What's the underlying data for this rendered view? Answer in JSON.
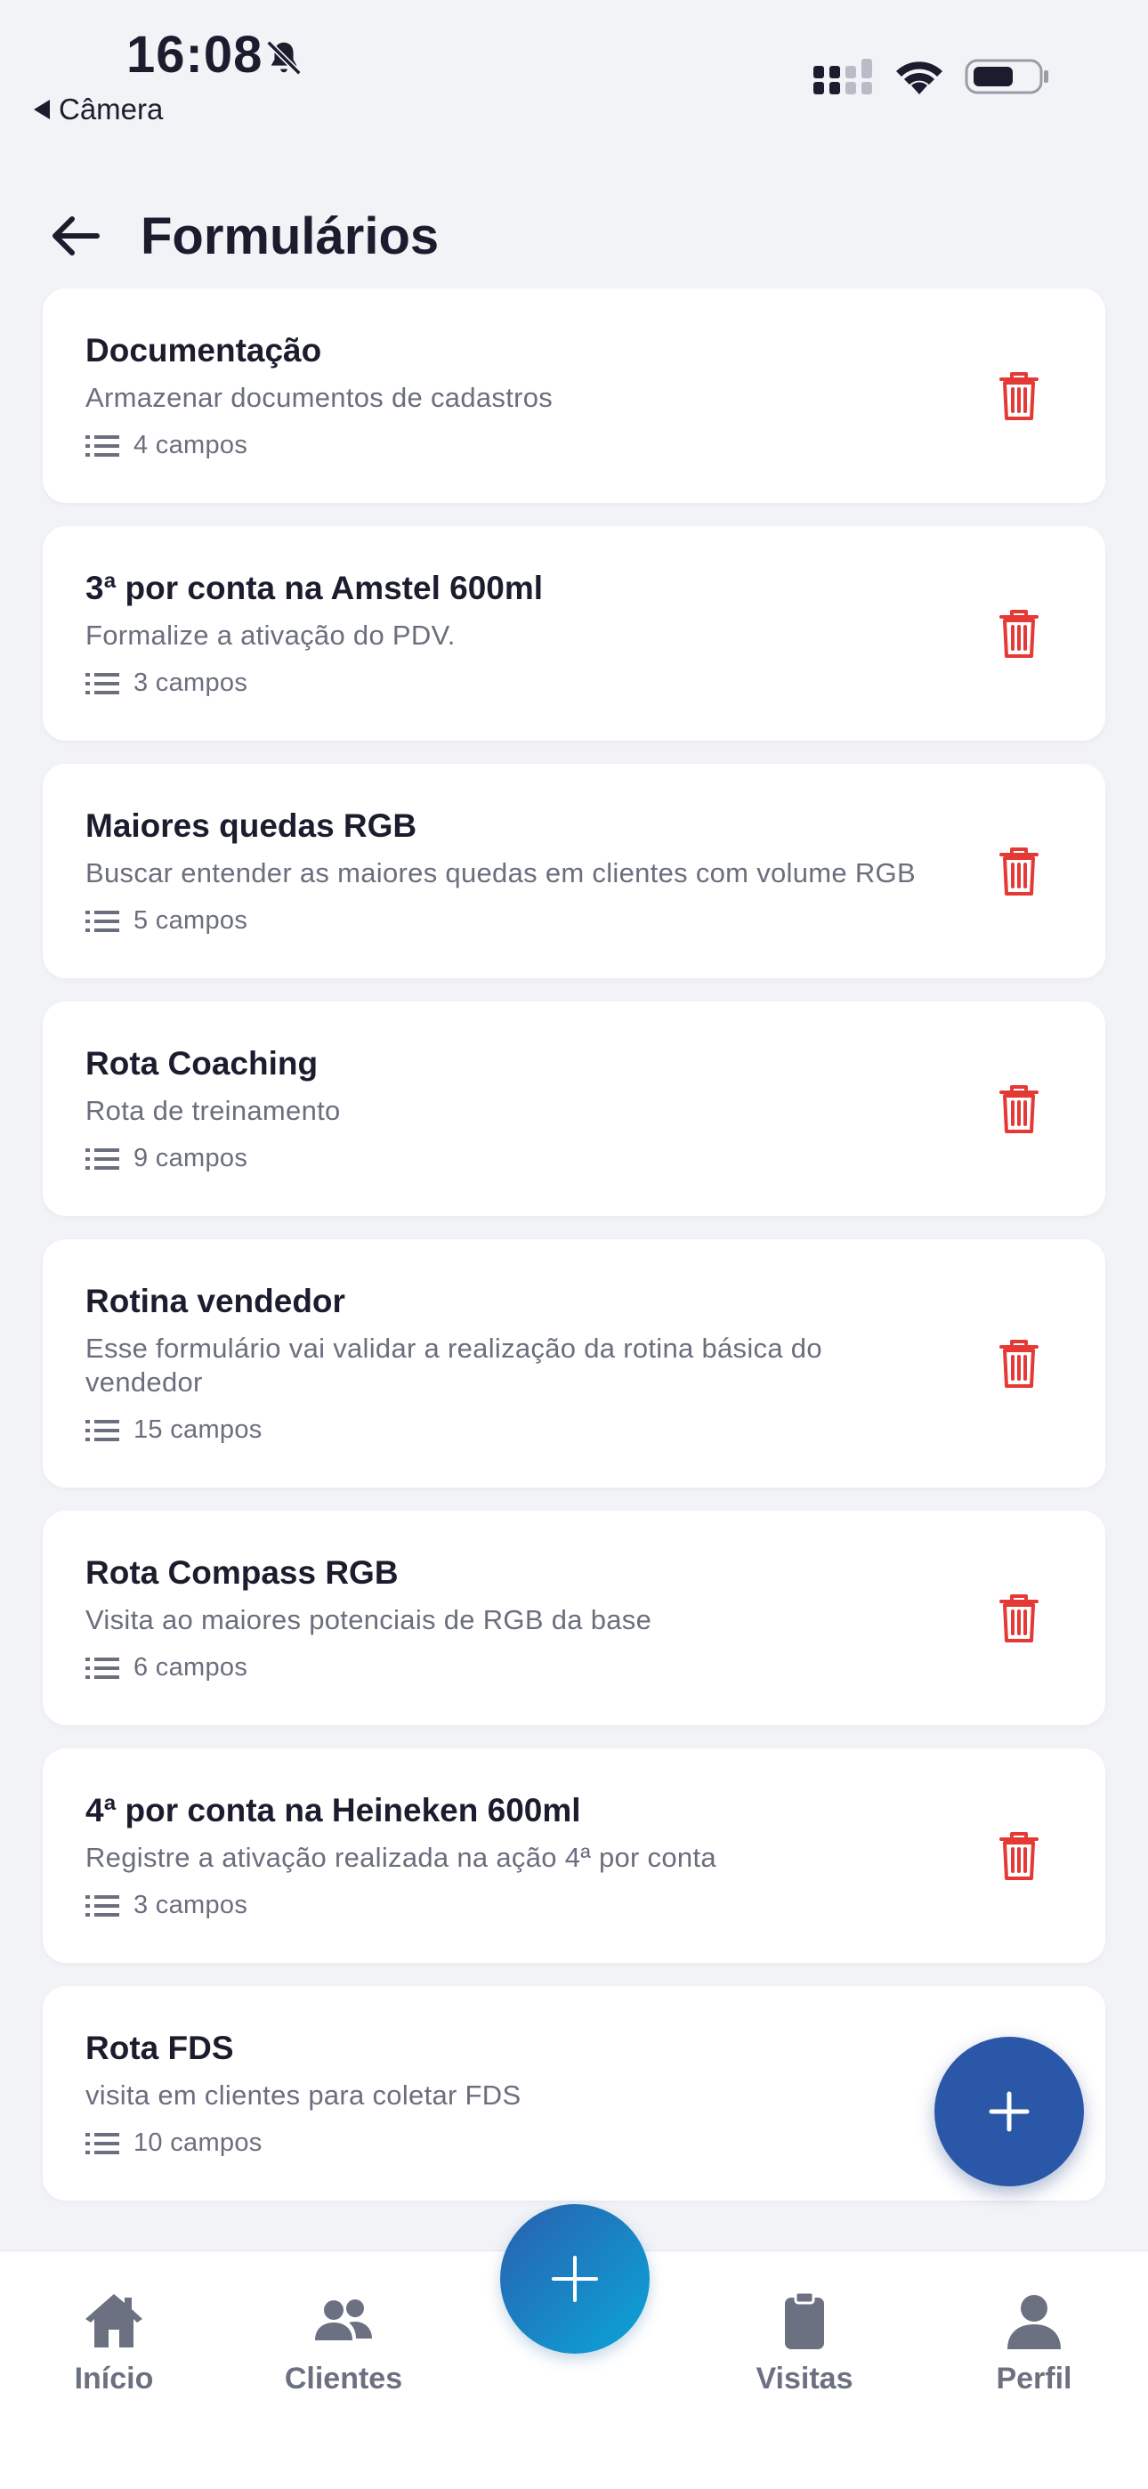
{
  "status_bar": {
    "time": "16:08",
    "back_app_label": "Câmera"
  },
  "header": {
    "title": "Formulários"
  },
  "forms": [
    {
      "title": "Documentação",
      "description": "Armazenar documentos de cadastros",
      "fields": "4 campos"
    },
    {
      "title": "3ª por conta na Amstel 600ml",
      "description": "Formalize a ativação do PDV.",
      "fields": "3 campos"
    },
    {
      "title": "Maiores quedas RGB",
      "description": "Buscar entender as maiores quedas em clientes com volume RGB",
      "fields": "5 campos"
    },
    {
      "title": "Rota Coaching",
      "description": "Rota de treinamento",
      "fields": "9 campos"
    },
    {
      "title": "Rotina vendedor",
      "description": "Esse formulário vai validar a realização da rotina básica do vendedor",
      "fields": "15 campos"
    },
    {
      "title": "Rota Compass RGB",
      "description": "Visita ao maiores potenciais de RGB da base",
      "fields": "6 campos"
    },
    {
      "title": "4ª por conta na Heineken 600ml",
      "description": "Registre a ativação realizada na ação 4ª por conta",
      "fields": "3 campos"
    },
    {
      "title": "Rota FDS",
      "description": "visita em clientes para coletar FDS",
      "fields": "10 campos"
    }
  ],
  "bottom_nav": {
    "home": "Início",
    "clients": "Clientes",
    "visits": "Visitas",
    "profile": "Perfil"
  },
  "icons": {
    "back": "arrow-left-icon",
    "trash": "trash-icon",
    "fields": "list-icon",
    "add": "plus-icon"
  },
  "colors": {
    "background": "#f2f3f7",
    "card": "#ffffff",
    "delete": "#e53935",
    "fab": "#2a57a7",
    "nav_inactive": "#6b7180"
  }
}
